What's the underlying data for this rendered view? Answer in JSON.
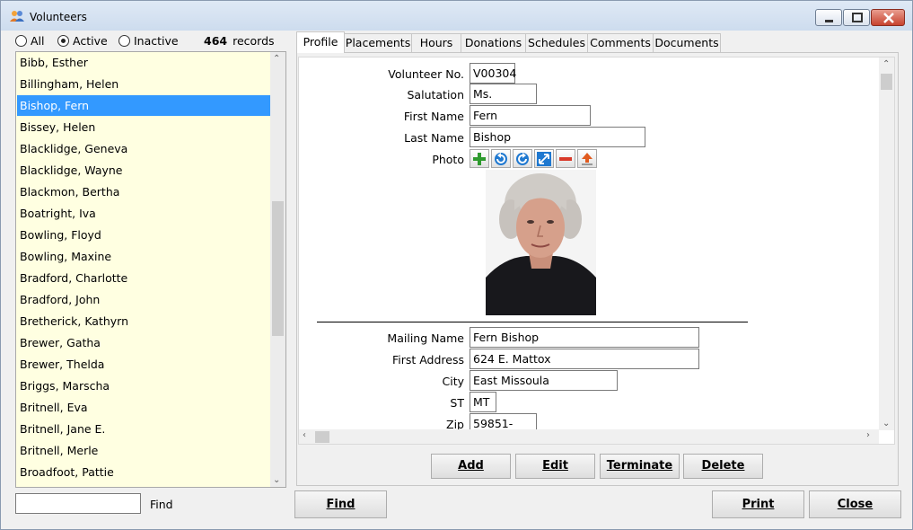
{
  "window": {
    "title": "Volunteers"
  },
  "filter": {
    "options": [
      {
        "label": "All",
        "selected": false
      },
      {
        "label": "Active",
        "selected": true
      },
      {
        "label": "Inactive",
        "selected": false
      }
    ],
    "record_count": "464",
    "record_label": "records"
  },
  "list": {
    "items": [
      "Bibb, Esther",
      "Billingham, Helen",
      "Bishop, Fern",
      "Bissey, Helen",
      "Blacklidge, Geneva",
      "Blacklidge, Wayne",
      "Blackmon, Bertha",
      "Boatright, Iva",
      "Bowling, Floyd",
      "Bowling, Maxine",
      "Bradford, Charlotte",
      "Bradford, John",
      "Bretherick, Kathyrn",
      "Brewer, Gatha",
      "Brewer, Thelda",
      "Briggs, Marscha",
      "Britnell, Eva",
      "Britnell, Jane E.",
      "Britnell, Merle",
      "Broadfoot, Pattie"
    ],
    "selected_index": 2
  },
  "find": {
    "value": "",
    "label": "Find"
  },
  "tabs": [
    "Profile",
    "Placements",
    "Hours",
    "Donations",
    "Schedules",
    "Comments",
    "Documents"
  ],
  "active_tab": "Profile",
  "form": {
    "volunteer_no": {
      "label": "Volunteer No.",
      "value": "V00304"
    },
    "salutation": {
      "label": "Salutation",
      "value": "Ms."
    },
    "first_name": {
      "label": "First Name",
      "value": "Fern"
    },
    "last_name": {
      "label": "Last Name",
      "value": "Bishop"
    },
    "photo": {
      "label": "Photo",
      "tools": [
        "add-icon",
        "rotate-left-icon",
        "rotate-right-icon",
        "resize-icon",
        "remove-icon",
        "upload-icon"
      ]
    },
    "mailing_name": {
      "label": "Mailing Name",
      "value": "Fern Bishop"
    },
    "first_address": {
      "label": "First Address",
      "value": "624 E. Mattox"
    },
    "city": {
      "label": "City",
      "value": "East Missoula"
    },
    "st": {
      "label": "ST",
      "value": "MT"
    },
    "zip": {
      "label": "Zip",
      "value": "59851-"
    }
  },
  "actions": {
    "add": "Add",
    "edit": "Edit",
    "terminate": "Terminate",
    "delete": "Delete"
  },
  "footer": {
    "find": "Find",
    "print": "Print",
    "close": "Close"
  }
}
